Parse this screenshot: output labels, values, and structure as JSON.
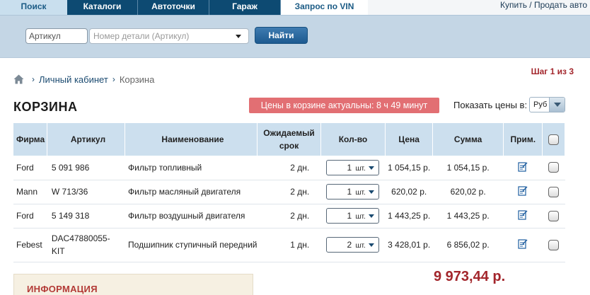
{
  "nav": {
    "tabs": [
      {
        "label": "Поиск"
      },
      {
        "label": "Каталоги"
      },
      {
        "label": "Автоточки"
      },
      {
        "label": "Гараж"
      },
      {
        "label": "Запрос по VIN"
      }
    ],
    "buy_sell": "Купить / Продать авто"
  },
  "search": {
    "article_value": "Артикул",
    "number_placeholder": "Номер детали (Артикул)",
    "find_label": "Найти"
  },
  "breadcrumb": {
    "items": [
      "Личный кабинет",
      "Корзина"
    ]
  },
  "step": "Шаг 1 из 3",
  "title": "КОРЗИНА",
  "timer": "Цены в корзине актуальны: 8 ч 49 минут",
  "price_currency": {
    "label": "Показать цены в:",
    "value": "Руб"
  },
  "table": {
    "headers": {
      "firm": "Фирма",
      "article": "Артикул",
      "name": "Наименование",
      "term_line1": "Ожидаемый",
      "term_line2": "срок",
      "qty": "Кол-во",
      "price": "Цена",
      "sum": "Сумма",
      "note": "Прим."
    },
    "rows": [
      {
        "firm": "Ford",
        "article": "5 091 986",
        "name": "Фильтр топливный",
        "term": "2 дн.",
        "qty": "1",
        "unit": "шт.",
        "price": "1 054,15 р.",
        "sum": "1 054,15 р."
      },
      {
        "firm": "Mann",
        "article": "W 713/36",
        "name": "Фильтр масляный двигателя",
        "term": "2 дн.",
        "qty": "1",
        "unit": "шт.",
        "price": "620,02 р.",
        "sum": "620,02 р."
      },
      {
        "firm": "Ford",
        "article": "5 149 318",
        "name": "Фильтр воздушный двигателя",
        "term": "2 дн.",
        "qty": "1",
        "unit": "шт.",
        "price": "1 443,25 р.",
        "sum": "1 443,25 р."
      },
      {
        "firm": "Febest",
        "article": "DAC47880055-KIT",
        "name": "Подшипник ступичный передний",
        "term": "1 дн.",
        "qty": "2",
        "unit": "шт.",
        "price": "3 428,01 р.",
        "sum": "6 856,02 р."
      }
    ]
  },
  "total": "9 973,44 р.",
  "info_title": "ИНФОРМАЦИЯ"
}
